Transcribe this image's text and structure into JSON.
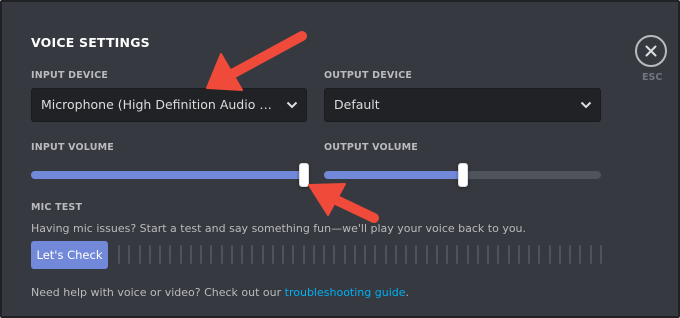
{
  "dialog": {
    "title": "VOICE SETTINGS",
    "close_label": "ESC"
  },
  "input_device": {
    "label": "INPUT DEVICE",
    "value": "Microphone (High Definition Audio Device)"
  },
  "output_device": {
    "label": "OUTPUT DEVICE",
    "value": "Default"
  },
  "input_volume": {
    "label": "INPUT VOLUME",
    "level": 0.99
  },
  "output_volume": {
    "label": "OUTPUT VOLUME",
    "level": 0.5
  },
  "mic_test": {
    "label": "MIC TEST",
    "description": "Having mic issues? Start a test and say something fun—we'll play your voice back to you.",
    "button_label": "Let's Check",
    "meter_segments": 48
  },
  "help": {
    "text": "Need help with voice or video? Check out our ",
    "link_text": "troubleshooting guide",
    "suffix": "."
  },
  "colors": {
    "background": "#36393f",
    "accent": "#7289da",
    "link": "#00b0f4",
    "annotation_arrow": "#f04a3a"
  },
  "icons": {
    "close": "close-icon",
    "dropdown": "chevron-down-icon"
  }
}
